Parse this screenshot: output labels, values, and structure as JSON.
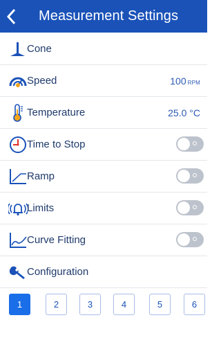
{
  "header": {
    "title": "Measurement Settings",
    "back_icon": "chevron-left-icon",
    "background": "#1a52b8"
  },
  "settings": [
    {
      "key": "cone",
      "label": "Cone",
      "icon": "cone-spindle-icon"
    },
    {
      "key": "speed",
      "label": "Speed",
      "icon": "speedometer-icon",
      "value": "100",
      "unit": "RPM"
    },
    {
      "key": "temperature",
      "label": "Temperature",
      "icon": "thermometer-icon",
      "value": "25.0 °C"
    },
    {
      "key": "time_to_stop",
      "label": "Time to Stop",
      "icon": "timer-icon",
      "toggle": "off"
    },
    {
      "key": "ramp",
      "label": "Ramp",
      "icon": "ramp-chart-icon",
      "toggle": "off"
    },
    {
      "key": "limits",
      "label": "Limits",
      "icon": "alarm-bell-icon",
      "toggle": "off"
    },
    {
      "key": "curve_fitting",
      "label": "Curve Fitting",
      "icon": "curve-chart-icon",
      "toggle": "off"
    },
    {
      "key": "configuration",
      "label": "Configuration",
      "icon": "wrench-icon"
    }
  ],
  "pager": {
    "pages": [
      "1",
      "2",
      "3",
      "4",
      "5",
      "6"
    ],
    "active": "1"
  },
  "colors": {
    "accent": "#1a52b8",
    "active_page": "#1a6ee8",
    "toggle_off": "#bdc3cc",
    "text": "#1f3a6b",
    "icon_orange": "#f2a41c",
    "timer_red": "#e0302b"
  }
}
